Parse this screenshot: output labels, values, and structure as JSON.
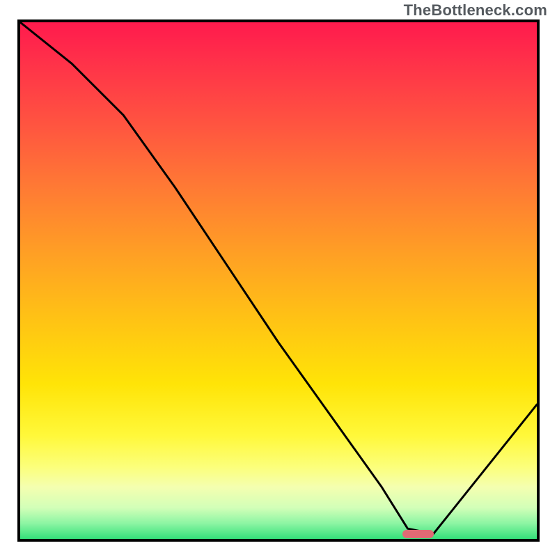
{
  "watermark": "TheBottleneck.com",
  "colors": {
    "border": "#000000",
    "curve": "#000000",
    "marker": "#e06a74",
    "gradient_top": "#ff1a4d",
    "gradient_mid": "#ffe407",
    "gradient_bottom": "#34e07a"
  },
  "chart_data": {
    "type": "line",
    "title": "",
    "xlabel": "",
    "ylabel": "",
    "xlim": [
      0,
      100
    ],
    "ylim": [
      0,
      100
    ],
    "grid": false,
    "legend": false,
    "series": [
      {
        "name": "bottleneck-curve",
        "x": [
          0,
          10,
          20,
          30,
          40,
          50,
          60,
          70,
          75,
          80,
          100
        ],
        "y": [
          100,
          92,
          82,
          68,
          53,
          38,
          24,
          10,
          2,
          1,
          26
        ]
      }
    ],
    "marker": {
      "x_start": 74,
      "x_end": 80,
      "y": 1
    },
    "notes": "y=0 is bottom (green / no bottleneck), y=100 is top (red / high bottleneck). Values estimated from pixel positions."
  }
}
